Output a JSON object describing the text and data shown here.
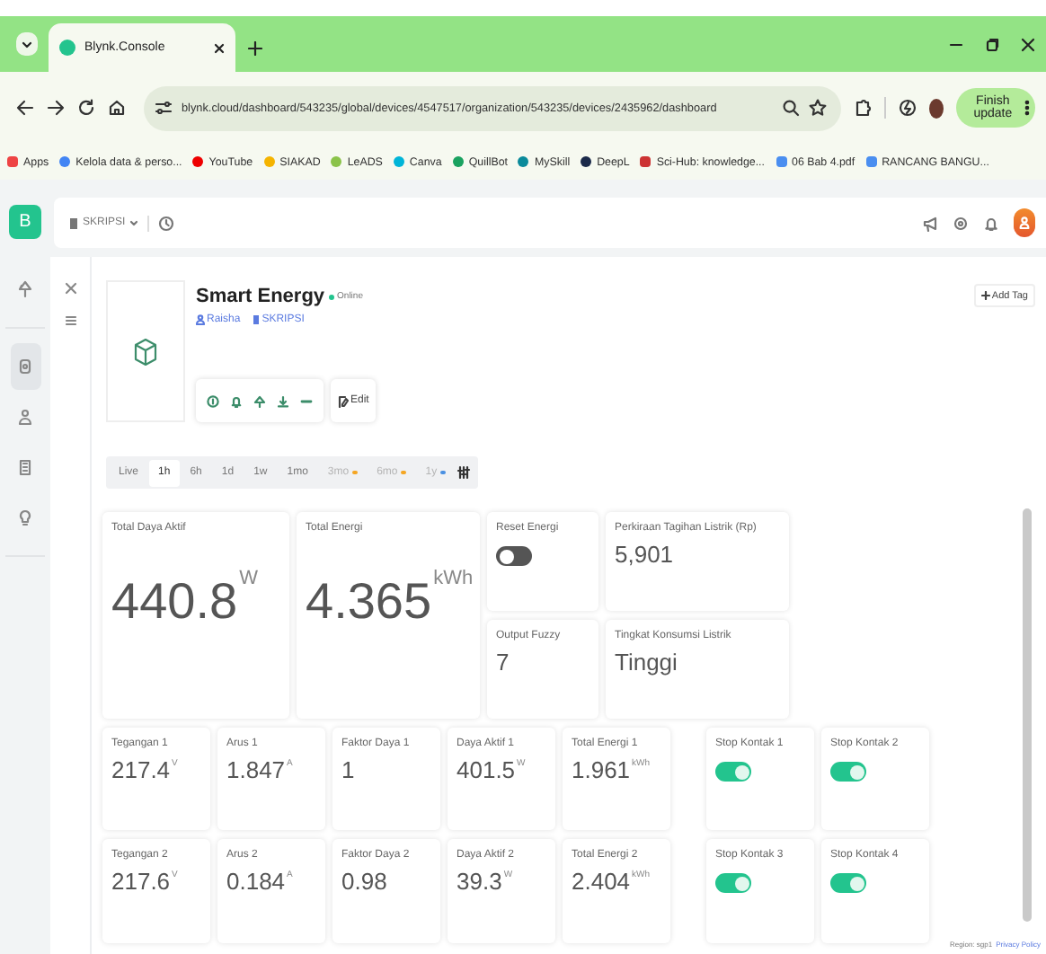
{
  "browser": {
    "tabs": [
      {
        "title": "Blynk.Console",
        "selected": true
      }
    ],
    "url": "blynk.cloud/dashboard/543235/global/devices/4547517/organization/543235/devices/2435962/dashboard",
    "update_button": "Finish update",
    "bookmarks": [
      "Apps",
      "Kelola data & perso...",
      "YouTube",
      "SIAKAD",
      "LeADS",
      "Canva",
      "QuillBot",
      "MySkill",
      "DeepL",
      "Sci-Hub: knowledge...",
      "06 Bab 4.pdf",
      "RANCANG BANGU..."
    ]
  },
  "app": {
    "logo": "B",
    "organization": "SKRIPSI",
    "nav_items": [
      {
        "selected": false
      },
      {
        "selected": true
      },
      {
        "selected": false
      },
      {
        "selected": false
      },
      {
        "selected": false
      }
    ]
  },
  "device": {
    "name": "Smart Energy",
    "status": "Online",
    "online": true,
    "owner": "Raisha",
    "organization": "SKRIPSI",
    "edit_button": "Edit",
    "add_tag_button": "Add Tag"
  },
  "time_ranges": [
    {
      "label": "Live",
      "selected": false,
      "disabled": false
    },
    {
      "label": "1h",
      "selected": true,
      "disabled": false
    },
    {
      "label": "6h",
      "selected": false,
      "disabled": false
    },
    {
      "label": "1d",
      "selected": false,
      "disabled": false
    },
    {
      "label": "1w",
      "selected": false,
      "disabled": false
    },
    {
      "label": "1mo",
      "selected": false,
      "disabled": false
    },
    {
      "label": "3mo",
      "selected": false,
      "disabled": true,
      "color": "#f5a623"
    },
    {
      "label": "6mo",
      "selected": false,
      "disabled": true,
      "color": "#f5a623"
    },
    {
      "label": "1y",
      "selected": false,
      "disabled": true,
      "color": "#4a90e2"
    }
  ],
  "widgets": [
    {
      "kind": "big_value",
      "label": "Total Daya Aktif",
      "value": "440.8",
      "unit": "W"
    },
    {
      "kind": "big_value",
      "label": "Total Energi",
      "value": "4.365",
      "unit": "kWh"
    },
    {
      "kind": "switch",
      "label": "Reset Energi",
      "on": false
    },
    {
      "kind": "value",
      "label": "Perkiraan Tagihan Listrik (Rp)",
      "value": "5,901"
    },
    {
      "kind": "value",
      "label": "Output Fuzzy",
      "value": "7"
    },
    {
      "kind": "value",
      "label": "Tingkat Konsumsi Listrik",
      "value": "Tinggi"
    }
  ],
  "channel_widgets": [
    [
      {
        "kind": "value",
        "label": "Tegangan 1",
        "value": "217.4",
        "unit": "V"
      },
      {
        "kind": "value",
        "label": "Arus 1",
        "value": "1.847",
        "unit": "A"
      },
      {
        "kind": "value",
        "label": "Faktor Daya 1",
        "value": "1"
      },
      {
        "kind": "value",
        "label": "Daya Aktif 1",
        "value": "401.5",
        "unit": "W"
      },
      {
        "kind": "value",
        "label": "Total Energi 1",
        "value": "1.961",
        "unit": "kWh"
      },
      {
        "kind": "switch",
        "label": "Stop Kontak 1",
        "on": true
      },
      {
        "kind": "switch",
        "label": "Stop Kontak 2",
        "on": true
      }
    ],
    [
      {
        "kind": "value",
        "label": "Tegangan 2",
        "value": "217.6",
        "unit": "V"
      },
      {
        "kind": "value",
        "label": "Arus 2",
        "value": "0.184",
        "unit": "A"
      },
      {
        "kind": "value",
        "label": "Faktor Daya 2",
        "value": "0.98"
      },
      {
        "kind": "value",
        "label": "Daya Aktif 2",
        "value": "39.3",
        "unit": "W"
      },
      {
        "kind": "value",
        "label": "Total Energi 2",
        "value": "2.404",
        "unit": "kWh"
      },
      {
        "kind": "switch",
        "label": "Stop Kontak 3",
        "on": true
      },
      {
        "kind": "switch",
        "label": "Stop Kontak 4",
        "on": true
      }
    ]
  ],
  "footer": {
    "region": "Region: sgp1",
    "privacy_link": "Privacy Policy"
  }
}
